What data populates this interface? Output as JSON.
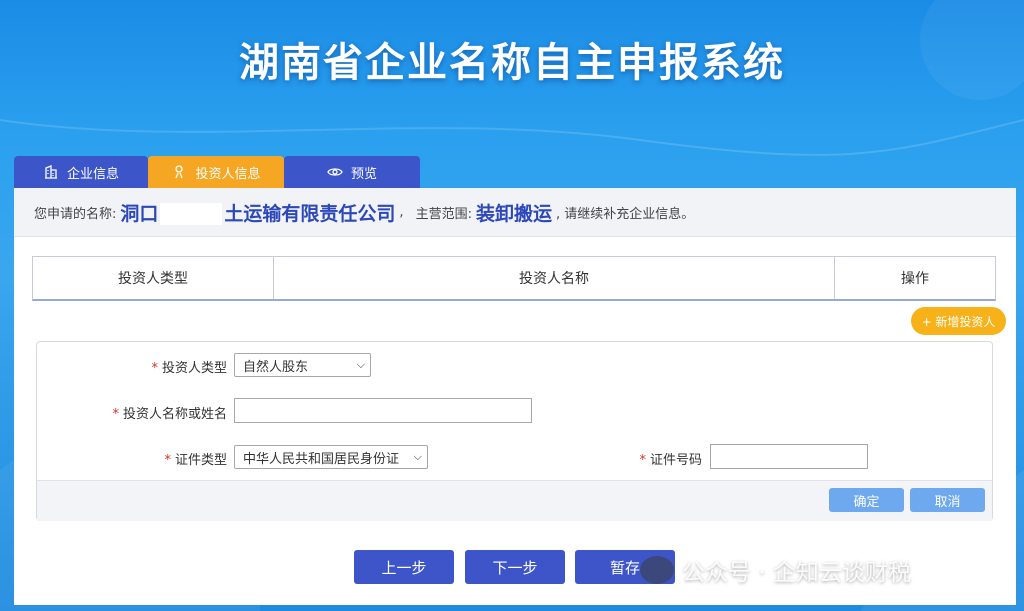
{
  "banner": {
    "title": "湖南省企业名称自主申报系统"
  },
  "tabs": [
    {
      "label": "企业信息",
      "icon": "building-icon",
      "active": false
    },
    {
      "label": "投资人信息",
      "icon": "user-icon",
      "active": true
    },
    {
      "label": "预览",
      "icon": "eye-icon",
      "active": false
    }
  ],
  "info": {
    "prefix": "您申请的名称:",
    "name_start": "洞口",
    "name_end": "土运输有限责任公司",
    "sep": ",",
    "scope_label": "主营范围:",
    "scope_value": "装卸搬运",
    "suffix": ",  请继续补充企业信息。"
  },
  "table": {
    "columns": [
      "投资人类型",
      "投资人名称",
      "操作"
    ]
  },
  "add_investor": "+ 新增投资人",
  "form": {
    "type_label": "投资人类型",
    "type_value": "自然人股东",
    "name_label": "投资人名称或姓名",
    "name_value": "",
    "id_type_label": "证件类型",
    "id_type_value": "中华人民共和国居民身份证",
    "id_number_label": "证件号码",
    "id_number_value": "",
    "required_mark": "*",
    "confirm": "确定",
    "cancel": "取消"
  },
  "nav": {
    "prev": "上一步",
    "next": "下一步",
    "save": "暂存"
  },
  "watermark": {
    "text": "公众号 · 企知云谈财税"
  },
  "colors": {
    "primary": "#3d55c9",
    "accent": "#f5a623",
    "light_btn": "#6ea8ee",
    "required": "#e02b2b"
  }
}
